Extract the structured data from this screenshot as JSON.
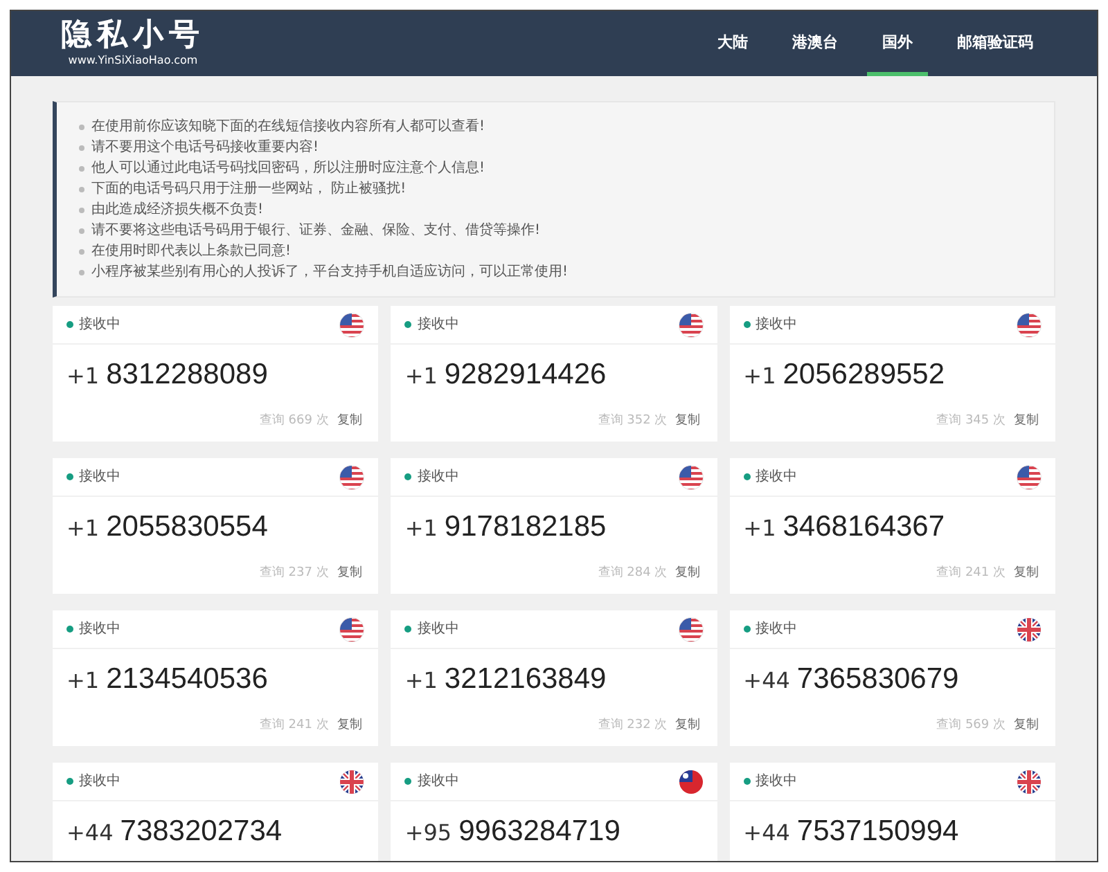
{
  "header": {
    "logo": "隐私小号",
    "logo_url": "www.YinSiXiaoHao.com",
    "nav": [
      {
        "label": "大陆",
        "selected": false
      },
      {
        "label": "港澳台",
        "selected": false
      },
      {
        "label": "国外",
        "selected": true
      },
      {
        "label": "邮箱验证码",
        "selected": false
      }
    ]
  },
  "notices": [
    "在使用前你应该知晓下面的在线短信接收内容所有人都可以查看!",
    "请不要用这个电话号码接收重要内容!",
    "他人可以通过此电话号码找回密码，所以注册时应注意个人信息!",
    "下面的电话号码只用于注册一些网站， 防止被骚扰!",
    "由此造成经济损失概不负责!",
    "请不要将这些电话号码用于银行、证券、金融、保险、支付、借贷等操作!",
    "在使用时即代表以上条款已同意!",
    "小程序被某些别有用心的人投诉了，平台支持手机自适应访问，可以正常使用!"
  ],
  "cards": [
    {
      "status": "接收中",
      "kind": "us",
      "code": "+1",
      "number": "8312288089",
      "queries": "查询 669 次",
      "copy": "复制"
    },
    {
      "status": "接收中",
      "kind": "us",
      "code": "+1",
      "number": "9282914426",
      "queries": "查询 352 次",
      "copy": "复制"
    },
    {
      "status": "接收中",
      "kind": "us",
      "code": "+1",
      "number": "2056289552",
      "queries": "查询 345 次",
      "copy": "复制"
    },
    {
      "status": "接收中",
      "kind": "us",
      "code": "+1",
      "number": "2055830554",
      "queries": "查询 237 次",
      "copy": "复制"
    },
    {
      "status": "接收中",
      "kind": "us",
      "code": "+1",
      "number": "9178182185",
      "queries": "查询 284 次",
      "copy": "复制"
    },
    {
      "status": "接收中",
      "kind": "us",
      "code": "+1",
      "number": "3468164367",
      "queries": "查询 241 次",
      "copy": "复制"
    },
    {
      "status": "接收中",
      "kind": "us",
      "code": "+1",
      "number": "2134540536",
      "queries": "查询 241 次",
      "copy": "复制"
    },
    {
      "status": "接收中",
      "kind": "us",
      "code": "+1",
      "number": "3212163849",
      "queries": "查询 232 次",
      "copy": "复制"
    },
    {
      "status": "接收中",
      "kind": "uk",
      "code": "+44",
      "number": "7365830679",
      "queries": "查询 569 次",
      "copy": "复制"
    },
    {
      "status": "接收中",
      "kind": "uk",
      "code": "+44",
      "number": "7383202734"
    },
    {
      "status": "接收中",
      "kind": "tw",
      "code": "+95",
      "number": "9963284719"
    },
    {
      "status": "接收中",
      "kind": "uk",
      "code": "+44",
      "number": "7537150994"
    }
  ]
}
